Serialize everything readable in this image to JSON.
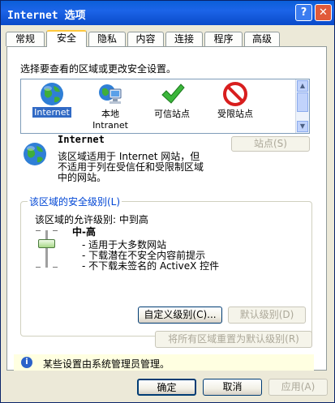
{
  "window": {
    "title": "Internet 选项"
  },
  "titlebar": {
    "help_label": "?",
    "close_label": "✕"
  },
  "tabs": [
    {
      "label": "常规"
    },
    {
      "label": "安全"
    },
    {
      "label": "隐私"
    },
    {
      "label": "内容"
    },
    {
      "label": "连接"
    },
    {
      "label": "程序"
    },
    {
      "label": "高级"
    }
  ],
  "active_tab": "安全",
  "security": {
    "select_zone_prompt": "选择要查看的区域或更改安全设置。",
    "zones": [
      {
        "name": "Internet",
        "icon": "globe-icon",
        "selected": true
      },
      {
        "name": "本地\nIntranet",
        "name_line1": "本地",
        "name_line2": "Intranet",
        "icon": "intranet-computer-icon",
        "selected": false
      },
      {
        "name": "可信站点",
        "icon": "green-check-icon",
        "selected": false
      },
      {
        "name": "受限站点",
        "icon": "red-no-entry-icon",
        "selected": false
      }
    ],
    "zone_detail": {
      "name": "Internet",
      "description_line1": "该区域适用于 Internet 网站，但",
      "description_line2": "不适用于列在受信任和受限制区域",
      "description_line3": "中的网站。",
      "sites_button": "站点(S)"
    },
    "level_group": {
      "title": "该区域的安全级别(L)",
      "allowed_levels": "该区域的允许级别: 中到高",
      "level_name": "中-高",
      "bullet1": "- 适用于大多数网站",
      "bullet2": "- 下载潜在不安全内容前提示",
      "bullet3": "- 不下载未签名的 ActiveX 控件",
      "slider_level_index": 2,
      "slider_level_count": 4,
      "custom_level_button": "自定义级别(C)...",
      "default_level_button": "默认级别(D)"
    },
    "reset_all_button": "将所有区域重置为默认级别(R)",
    "admin_note": "某些设置由系统管理员管理。"
  },
  "footer": {
    "ok_button": "确定",
    "cancel_button": "取消",
    "apply_button": "应用(A)"
  },
  "colors": {
    "titlebar": "#0b5fd8",
    "selection": "#316ac5",
    "group_title": "#0046d5",
    "infobar": "#ffffe1"
  }
}
